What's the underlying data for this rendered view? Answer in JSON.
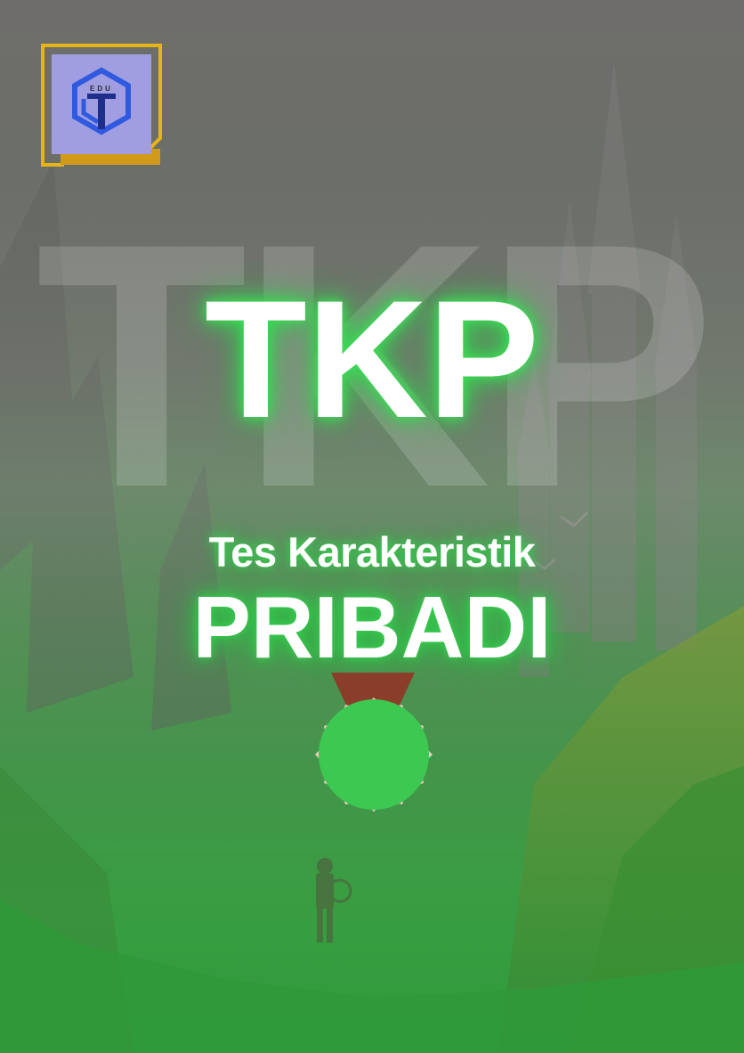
{
  "cover": {
    "watermark": "TKP",
    "title": "TKP",
    "subtitle_line1": "Tes Karakteristik",
    "subtitle_line2": "PRIBADI"
  },
  "logo": {
    "icon": "edu-hexagon-logo-icon",
    "text": "EDU"
  },
  "medal": {
    "icon": "medal-icon"
  },
  "colors": {
    "accent_green": "#3cc851",
    "glow_green": "#3cdc55",
    "logo_frame": "#e6b417",
    "logo_blue": "#2f5ae0",
    "logo_panel": "#a09ee0",
    "ribbon": "#8a3e2a",
    "medal_rim": "#f7c7c4",
    "background_top": "#707070",
    "background_bottom": "#2f9c3c"
  }
}
